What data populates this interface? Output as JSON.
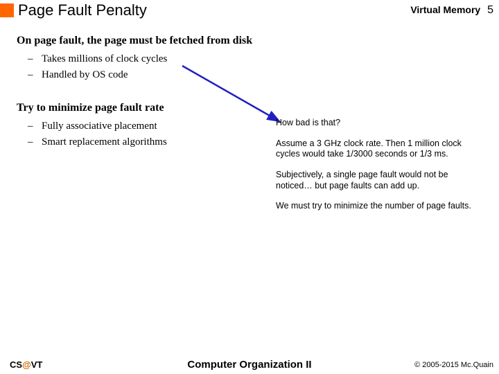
{
  "header": {
    "title": "Page Fault Penalty",
    "section": "Virtual Memory",
    "page_number": "5"
  },
  "content": {
    "heading1": "On page fault, the page must be fetched from disk",
    "bullets1": [
      "Takes millions of clock cycles",
      "Handled by OS code"
    ],
    "heading2": "Try to minimize page fault rate",
    "bullets2": [
      "Fully associative placement",
      "Smart replacement algorithms"
    ]
  },
  "sidebar": {
    "p1": "How bad is that?",
    "p2": "Assume a 3 GHz clock rate. Then 1 million clock cycles would take 1/3000 seconds or 1/3 ms.",
    "p3": "Subjectively, a single page fault would not be noticed… but page faults can add up.",
    "p4": "We must try to minimize the number of page faults."
  },
  "footer": {
    "left_cs": "CS",
    "left_at": "@",
    "left_vt": "VT",
    "center": "Computer Organization II",
    "right": "© 2005-2015 Mc.Quain"
  },
  "accent_color": "#ff6600",
  "arrow_color": "#2020c0"
}
